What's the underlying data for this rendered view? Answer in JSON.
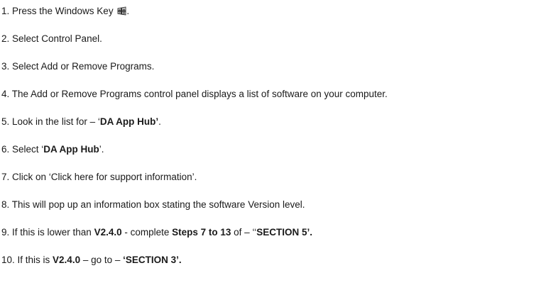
{
  "steps": [
    {
      "num": "1.",
      "parts": [
        {
          "t": "Press the Windows Key "
        }
      ],
      "icon": "windows-key-icon",
      "after_icon": "."
    },
    {
      "num": "2.",
      "parts": [
        {
          "t": "Select Control Panel."
        }
      ]
    },
    {
      "num": "3.",
      "parts": [
        {
          "t": "Select Add or Remove Programs."
        }
      ]
    },
    {
      "num": "4.",
      "parts": [
        {
          "t": "The Add or Remove Programs control panel displays a list of software on your computer."
        }
      ]
    },
    {
      "num": "5.",
      "parts": [
        {
          "t": "Look in the list for – ‘"
        },
        {
          "t": "DA App Hub’",
          "b": true
        },
        {
          "t": "."
        }
      ]
    },
    {
      "num": "6.",
      "parts": [
        {
          "t": "Select ‘"
        },
        {
          "t": "DA App Hub",
          "b": true
        },
        {
          "t": "’."
        }
      ]
    },
    {
      "num": "7.",
      "parts": [
        {
          "t": "Click on ‘Click here for support information’."
        }
      ]
    },
    {
      "num": "8.",
      "parts": [
        {
          "t": "This will pop up an information box stating the software Version level."
        }
      ]
    },
    {
      "num": "9.",
      "parts": [
        {
          "t": "If this is lower than "
        },
        {
          "t": "V2.4.0",
          "b": true
        },
        {
          "t": " - complete "
        },
        {
          "t": "Steps 7 to 13",
          "b": true
        },
        {
          "t": " of – ‘‘"
        },
        {
          "t": "SECTION 5’.",
          "b": true
        }
      ]
    },
    {
      "num": "10.",
      "parts": [
        {
          "t": "If this is "
        },
        {
          "t": "V2.4.0",
          "b": true
        },
        {
          "t": " – go to – "
        },
        {
          "t": "‘SECTION 3’.",
          "b": true
        }
      ]
    }
  ]
}
